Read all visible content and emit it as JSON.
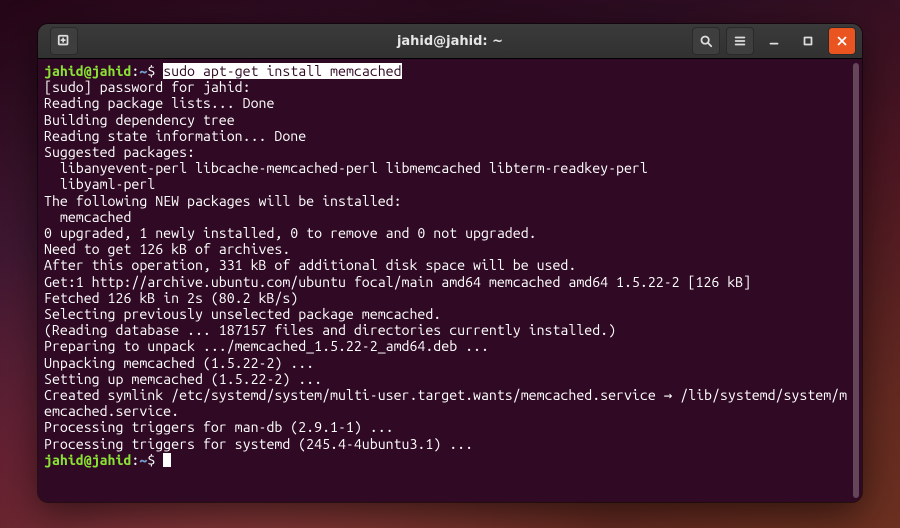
{
  "titlebar": {
    "title": "jahid@jahid: ~"
  },
  "prompt": {
    "user_host": "jahid@jahid",
    "sep": ":",
    "path": "~",
    "end": "$ "
  },
  "first_cmd": "sudo apt-get install memcached",
  "output_lines": [
    "[sudo] password for jahid:",
    "Reading package lists... Done",
    "Building dependency tree",
    "Reading state information... Done",
    "Suggested packages:",
    "  libanyevent-perl libcache-memcached-perl libmemcached libterm-readkey-perl",
    "  libyaml-perl",
    "The following NEW packages will be installed:",
    "  memcached",
    "0 upgraded, 1 newly installed, 0 to remove and 0 not upgraded.",
    "Need to get 126 kB of archives.",
    "After this operation, 331 kB of additional disk space will be used.",
    "Get:1 http://archive.ubuntu.com/ubuntu focal/main amd64 memcached amd64 1.5.22-2 [126 kB]",
    "Fetched 126 kB in 2s (80.2 kB/s)",
    "Selecting previously unselected package memcached.",
    "(Reading database ... 187157 files and directories currently installed.)",
    "Preparing to unpack .../memcached_1.5.22-2_amd64.deb ...",
    "Unpacking memcached (1.5.22-2) ...",
    "Setting up memcached (1.5.22-2) ...",
    "Created symlink /etc/systemd/system/multi-user.target.wants/memcached.service → /lib/systemd/system/memcached.service.",
    "Processing triggers for man-db (2.9.1-1) ...",
    "Processing triggers for systemd (245.4-4ubuntu3.1) ..."
  ]
}
